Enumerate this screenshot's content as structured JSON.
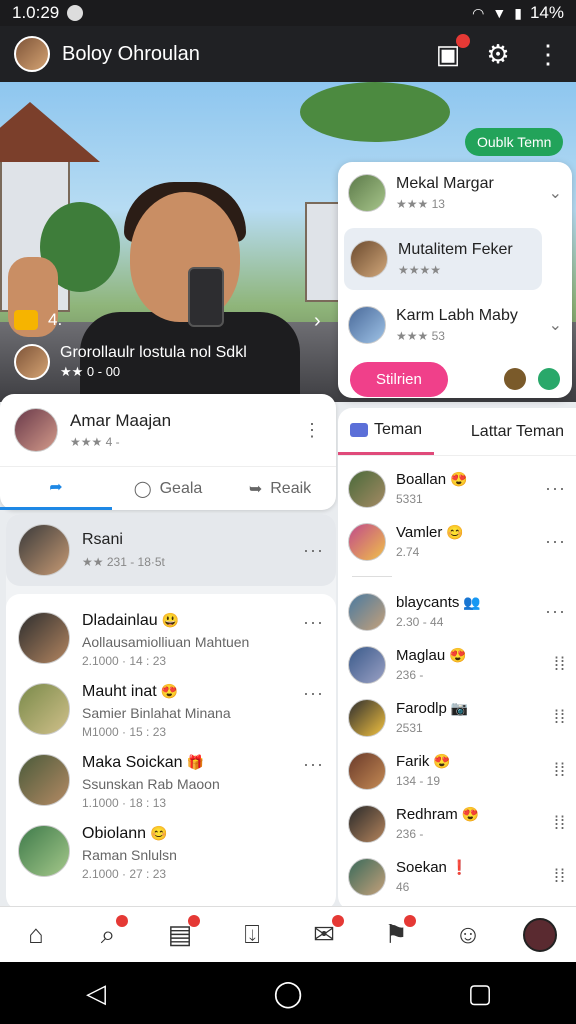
{
  "status": {
    "time": "1.0:29",
    "battery": "14%"
  },
  "appbar": {
    "title": "Boloy Ohroulan"
  },
  "hero": {
    "tag": "Oublk Temn",
    "count": "4.",
    "subtitle": "Grorollaulr lostula nol Sdkl",
    "stars": "★★ 0 - 00"
  },
  "suggestions": {
    "items": [
      {
        "name": "Mekal Margar",
        "meta": "★★★ 13"
      },
      {
        "name": "Mutalitem Feker",
        "meta": "★★★★"
      },
      {
        "name": "Karm Labh Maby",
        "meta": "★★★ 53"
      }
    ],
    "button": "Stilrien"
  },
  "profile": {
    "name": "Amar Maajan",
    "meta": "★★★ 4 -",
    "tabs": [
      "",
      "Geala",
      "Reaik"
    ]
  },
  "feed": {
    "top": {
      "name": "Rsani",
      "meta": "★★ 231 - 18·5t"
    },
    "items": [
      {
        "title": "Dladainlau",
        "sub": "Aollausamiolliuan Mahtuen",
        "meta": "2.1000 · 14 : 23"
      },
      {
        "title": "Mauht inat",
        "sub": "Samier Binlahat Minana",
        "meta": "M1000 · 15 : 23"
      },
      {
        "title": "Maka Soickan",
        "sub": "Ssunskan Rab Maoon",
        "meta": "1.1000 · 18 : 13"
      },
      {
        "title": "Obiolann",
        "sub": "Raman Snlulsn",
        "meta": "2.1000 · 27 : 23"
      }
    ]
  },
  "friends": {
    "tabs": [
      "Teman",
      "Lattar Teman"
    ],
    "items": [
      {
        "name": "Boallan",
        "meta": "5331"
      },
      {
        "name": "Vamler",
        "meta": "2.74"
      },
      {
        "name": "blaycants",
        "meta": "2.30 - 44"
      },
      {
        "name": "Maglau",
        "meta": "236 -"
      },
      {
        "name": "Farodlp",
        "meta": "2531"
      },
      {
        "name": "Farik",
        "meta": "134 - 19"
      },
      {
        "name": "Redhram",
        "meta": "236 -"
      },
      {
        "name": "Soekan",
        "meta": "46"
      }
    ]
  },
  "colors": {
    "accent": "#1e88e5",
    "pink": "#f0408a",
    "green": "#22a35a"
  }
}
